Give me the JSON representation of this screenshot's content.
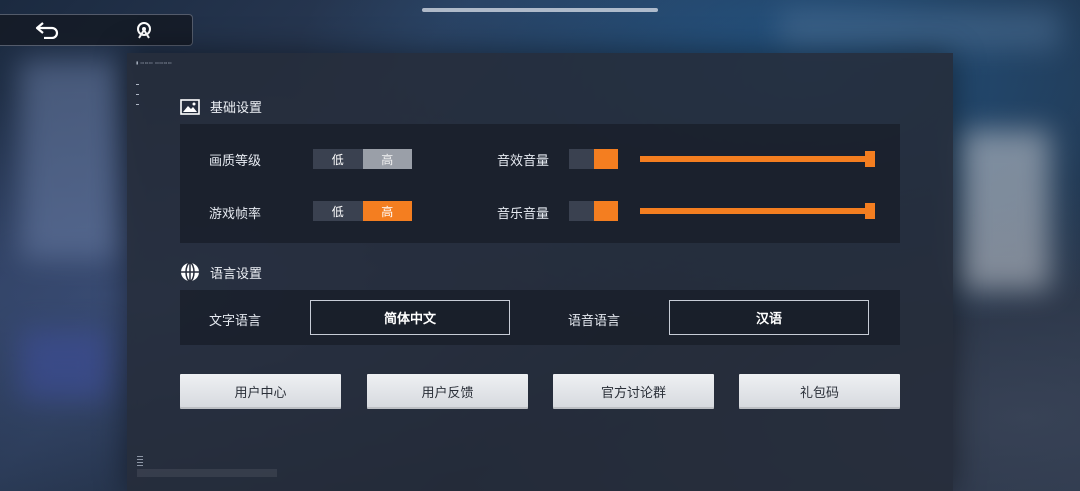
{
  "toolbar": {
    "back_icon": "back-arrow-icon",
    "mode_icon": "warp-icon"
  },
  "basic_settings": {
    "title": "基础设置",
    "icon": "image-icon",
    "graphics_quality": {
      "label": "画质等级",
      "options": [
        "低",
        "高"
      ],
      "selected": "高"
    },
    "frame_rate": {
      "label": "游戏帧率",
      "options": [
        "低",
        "高"
      ],
      "selected": "高"
    },
    "sfx_volume": {
      "label": "音效音量",
      "level": 1.0
    },
    "music_volume": {
      "label": "音乐音量",
      "level": 1.0
    }
  },
  "language_settings": {
    "title": "语言设置",
    "icon": "globe-icon",
    "text_language": {
      "label": "文字语言",
      "value": "简体中文"
    },
    "voice_language": {
      "label": "语音语言",
      "value": "汉语"
    }
  },
  "actions": {
    "user_center": "用户中心",
    "user_feedback": "用户反馈",
    "official_group": "官方讨论群",
    "gift_code": "礼包码"
  },
  "colors": {
    "accent": "#f47e20",
    "panel": "#262c3a",
    "button": "#e4e6ea"
  }
}
